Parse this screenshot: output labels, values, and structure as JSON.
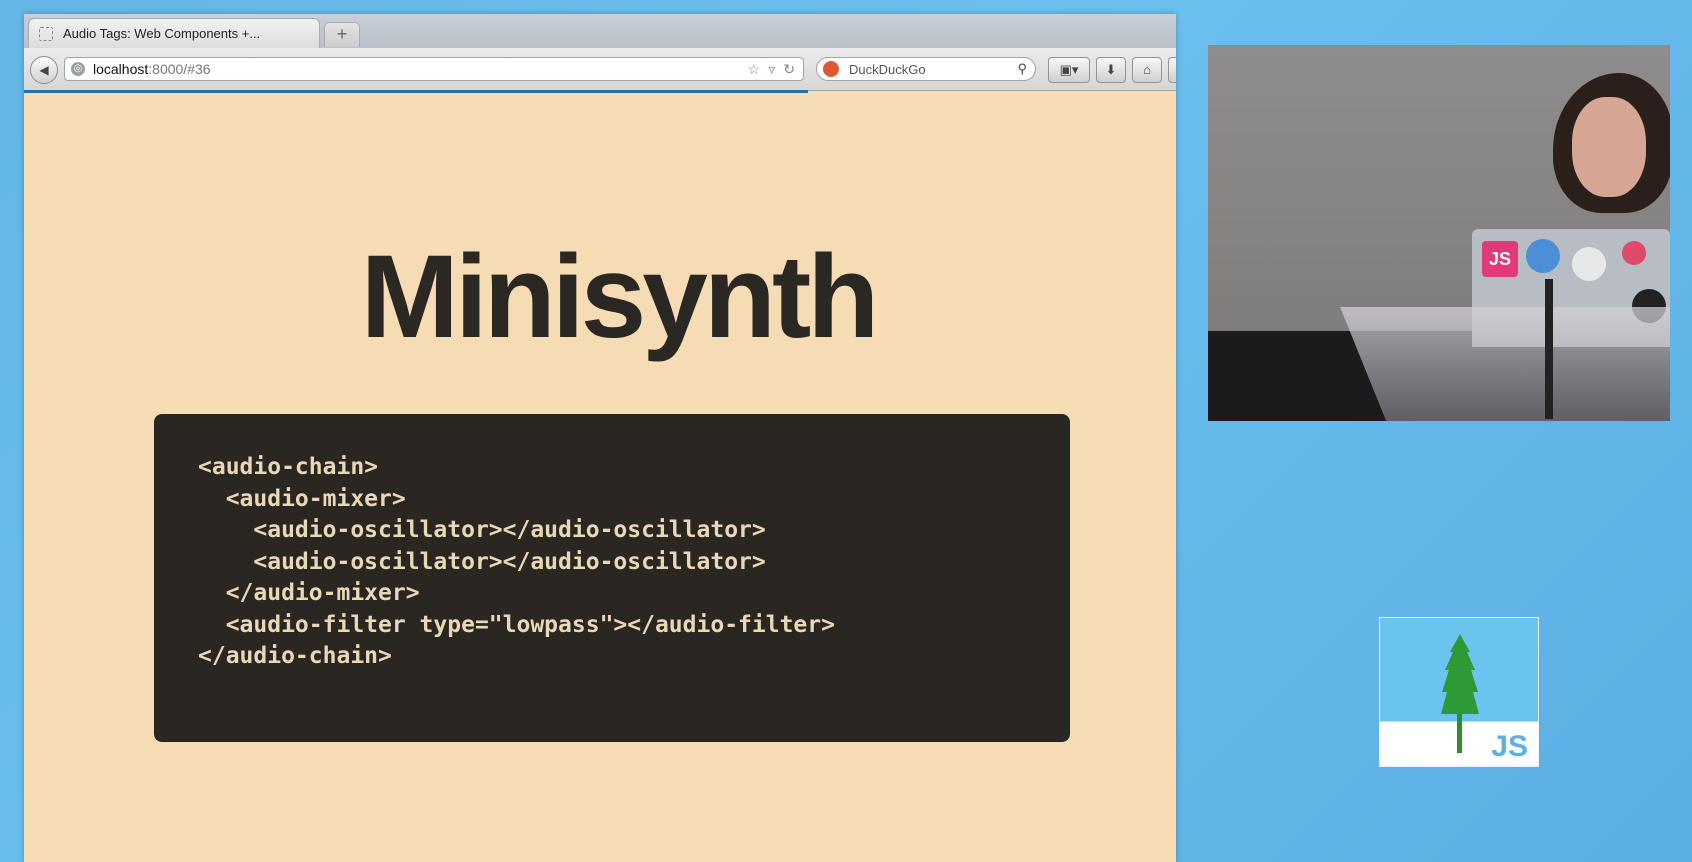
{
  "browser": {
    "tab_title": "Audio Tags: Web Components +...",
    "new_tab_label": "+",
    "url_host": "localhost",
    "url_path": ":8000/#36",
    "search_placeholder": "DuckDuckGo"
  },
  "slide": {
    "title": "Minisynth",
    "code_lines": [
      "<audio-chain>",
      "  <audio-mixer>",
      "    <audio-oscillator></audio-oscillator>",
      "    <audio-oscillator></audio-oscillator>",
      "  </audio-mixer>",
      "  <audio-filter type=\"lowpass\"></audio-filter>",
      "</audio-chain>"
    ]
  },
  "video": {
    "laptop_sticker_text": "JS"
  },
  "logo": {
    "text": "JS"
  },
  "colors": {
    "slide_background": "#f5dcb4",
    "code_background": "#2a2722",
    "code_text": "#ead7b6",
    "page_background": "#63b6e6"
  }
}
